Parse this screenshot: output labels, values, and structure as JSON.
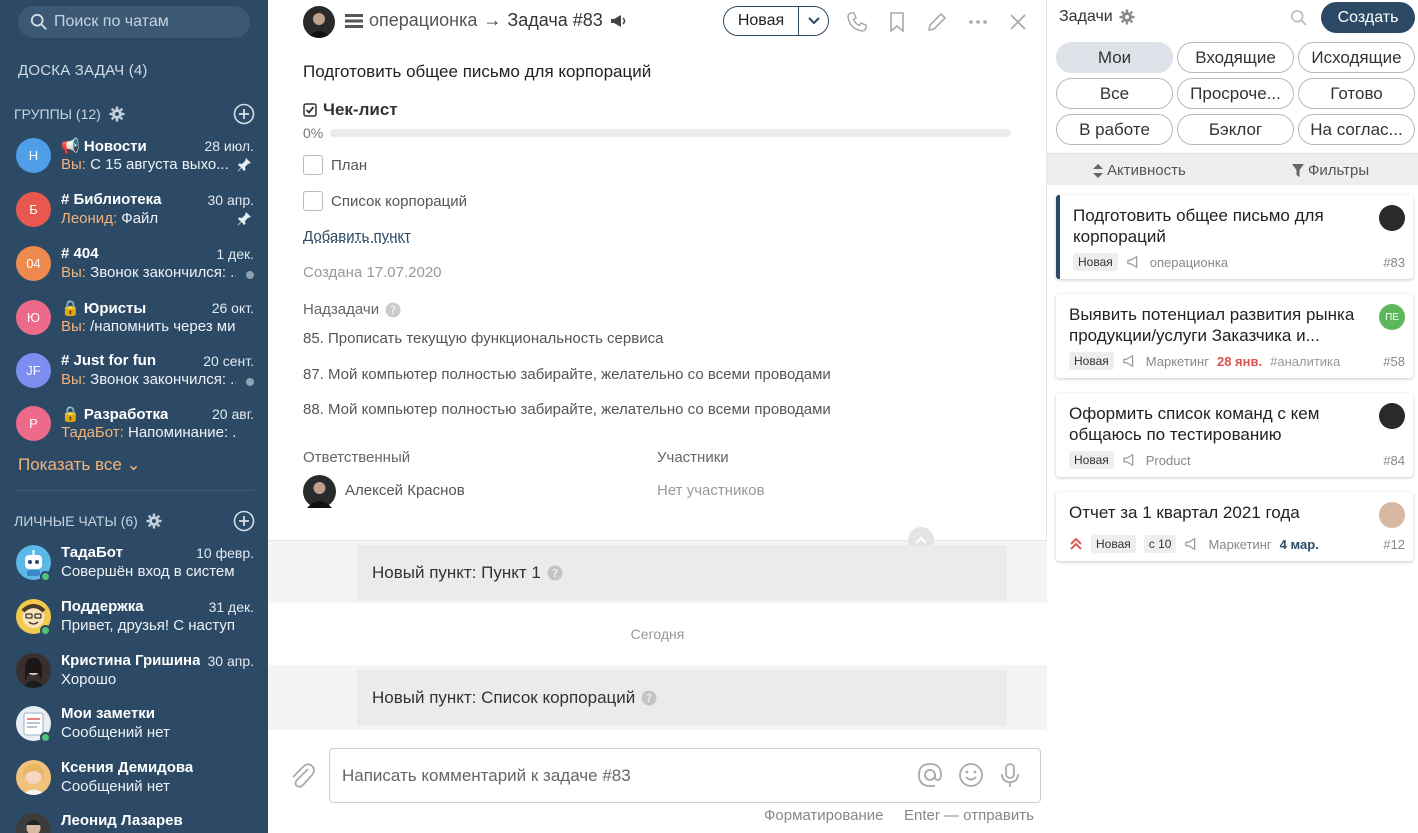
{
  "sidebar": {
    "search_placeholder": "Поиск по чатам",
    "board_label": "ДОСКА ЗАДАЧ (4)",
    "groups_label": "ГРУППЫ (12)",
    "groups": [
      {
        "initial": "Н",
        "color": "#4e9ee8",
        "name": "Новости",
        "prefix": "📢",
        "date": "28 июл.",
        "sender": "Вы:",
        "text": "С 15 августа выхо...",
        "pinned": true
      },
      {
        "initial": "Б",
        "color": "#e8584e",
        "name": "Библиотека",
        "prefix": "#",
        "date": "30 апр.",
        "sender": "Леонид:",
        "text": "Файл",
        "pinned": true
      },
      {
        "initial": "04",
        "color": "#ef8a4f",
        "name": "404",
        "prefix": "#",
        "date": "1 дек.",
        "sender": "Вы:",
        "text": "Звонок закончился: ...",
        "pinned": false
      },
      {
        "initial": "Ю",
        "color": "#ee6a8a",
        "name": "Юристы",
        "prefix": "🔒",
        "date": "26 окт.",
        "sender": "Вы:",
        "text": "/напомнить через ми...",
        "pinned": false
      },
      {
        "initial": "JF",
        "color": "#7d8ef0",
        "name": "Just for fun",
        "prefix": "#",
        "date": "20 сент.",
        "sender": "Вы:",
        "text": "Звонок закончился: ...",
        "pinned": false
      },
      {
        "initial": "Р",
        "color": "#ee6a8a",
        "name": "Разработка",
        "prefix": "🔒",
        "date": "20 авг.",
        "sender": "ТадаБот:",
        "text": "Напоминание: ...",
        "pinned": false
      }
    ],
    "show_all": "Показать все",
    "personal_label": "ЛИЧНЫЕ ЧАТЫ (6)",
    "personal": [
      {
        "name": "ТадаБот",
        "date": "10 февр.",
        "text": "Совершён вход в систем...",
        "color": "#5db8e8",
        "online": true
      },
      {
        "name": "Поддержка",
        "date": "31 дек.",
        "text": "Привет, друзья! С наступ...",
        "color": "#f2c94c",
        "online": true
      },
      {
        "name": "Кристина Гришина",
        "date": "30 апр.",
        "text": "Хорошо",
        "color": "#3a2e2e",
        "online": false
      },
      {
        "name": "Мои заметки",
        "date": "",
        "text": "Сообщений нет",
        "color": "#e8eef3",
        "online": true
      },
      {
        "name": "Ксения Демидова",
        "date": "",
        "text": "Сообщений нет",
        "color": "#f0c27b",
        "online": false
      },
      {
        "name": "Леонид Лазарев",
        "date": "",
        "text": "",
        "color": "#3c3c3c",
        "online": false
      }
    ]
  },
  "topbar": {
    "chat_name": "операционка",
    "arrow": "→",
    "task_ref": "Задача #83",
    "status": "Новая"
  },
  "task": {
    "title": "Подготовить общее письмо для корпораций",
    "checklist_label": "Чек-лист",
    "progress_text": "0%",
    "progress": 0,
    "items": [
      "План",
      "Список корпораций"
    ],
    "add_item": "Добавить пункт",
    "created": "Создана 17.07.2020",
    "parent_label": "Надзадачи",
    "parents": [
      "85. Прописать текущую функциональность сервиса",
      "87. Мой компьютер полностью забирайте, желательно со всеми проводами",
      "88. Мой компьютер полностью забирайте, желательно со всеми проводами"
    ],
    "responsible_label": "Ответственный",
    "responsible_name": "Алексей Краснов",
    "members_label": "Участники",
    "members_none": "Нет участников"
  },
  "feed": {
    "msg1": "Новый пункт: Пункт 1",
    "day": "Сегодня",
    "msg2": "Новый пункт: Список корпораций"
  },
  "composer": {
    "placeholder": "Написать комментарий к задаче #83",
    "format_hint": "Форматирование",
    "send_hint": "Enter — отправить"
  },
  "right": {
    "title": "Задачи",
    "create": "Создать",
    "filters": [
      "Мои",
      "Входящие",
      "Исходящие",
      "Все",
      "Просроче...",
      "Готово",
      "В работе",
      "Бэклог",
      "На соглас..."
    ],
    "active_filter": 0,
    "sort_label": "Активность",
    "filter_label": "Фильтры",
    "tasks": [
      {
        "title": "Подготовить общее письмо для корпораций",
        "badge": "Новая",
        "chat": "операционка",
        "date": "",
        "tag": "",
        "num": "#83",
        "selected": true,
        "avatar": "",
        "avatar_color": "#2a2a2a"
      },
      {
        "title": "Выявить потенциал развития рынка продукции/услуги Заказчика и...",
        "badge": "Новая",
        "chat": "Маркетинг",
        "date": "28 янв.",
        "tag": "#аналитика",
        "num": "#58",
        "selected": false,
        "avatar": "ПЕ",
        "avatar_color": "#5cb85c"
      },
      {
        "title": "Оформить список команд с кем общаюсь по тестированию",
        "badge": "Новая",
        "chat": "Product",
        "date": "",
        "tag": "",
        "num": "#84",
        "selected": false,
        "avatar": "",
        "avatar_color": "#2a2a2a"
      },
      {
        "title": "Отчет за 1 квартал 2021 года",
        "badge": "Новая",
        "extra": "с 10",
        "chat": "Маркетинг",
        "date": "4 мар.",
        "tag": "",
        "num": "#12",
        "selected": false,
        "avatar": "",
        "avatar_color": "#d8b8a0"
      }
    ]
  },
  "colors": {
    "sidebar_bg": "#2c4a66",
    "accent": "#2c4a66",
    "sender": "#f3b37b",
    "overdue": "#d9534f"
  }
}
